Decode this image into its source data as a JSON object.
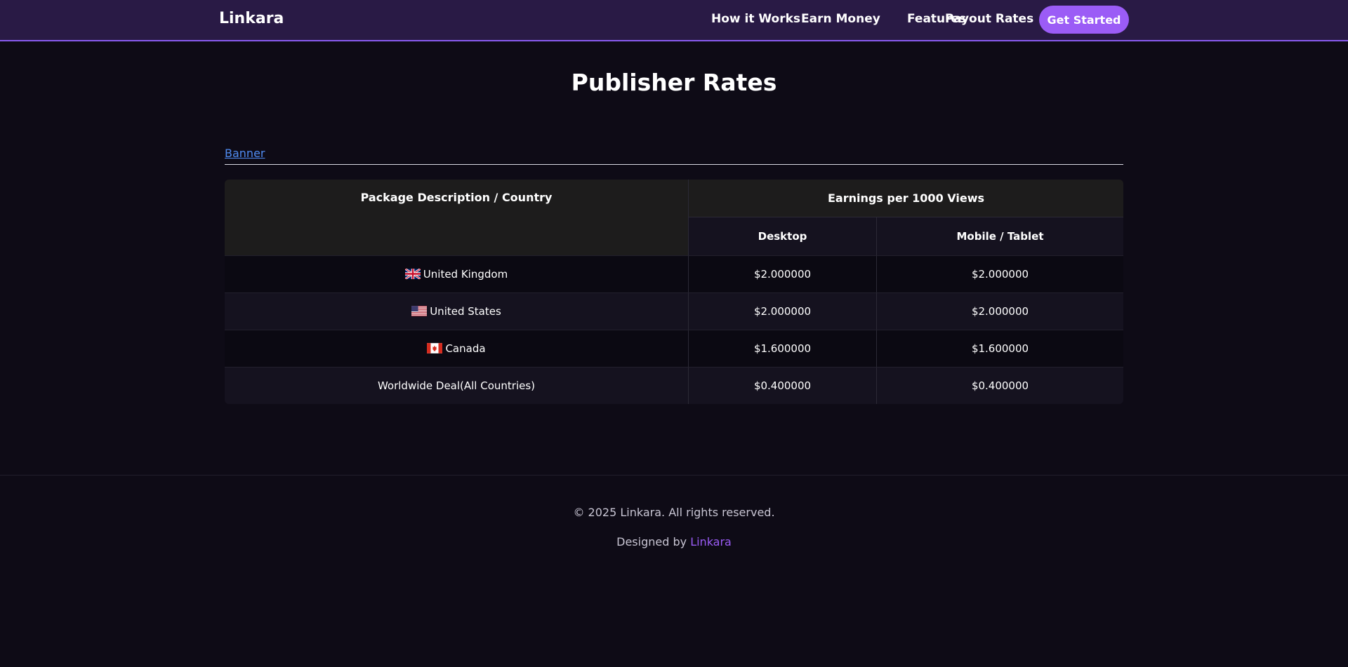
{
  "navbar": {
    "brand": "Linkara",
    "links": [
      "How it Works",
      "Earn Money",
      "Features",
      "Payout Rates"
    ],
    "cta_label": "Get Started"
  },
  "page": {
    "title": "Publisher Rates"
  },
  "tabs": {
    "active": "Banner"
  },
  "rates_table": {
    "headers": {
      "package": "Package Description / Country",
      "earnings": "Earnings per 1000 Views",
      "desktop": "Desktop",
      "mobile": "Mobile / Tablet"
    },
    "rows": [
      {
        "flag": "uk-flag-icon",
        "country": "United Kingdom",
        "desktop": "$2.000000",
        "mobile": "$2.000000"
      },
      {
        "flag": "us-flag-icon",
        "country": "United States",
        "desktop": "$2.000000",
        "mobile": "$2.000000"
      },
      {
        "flag": "canada-flag-icon",
        "country": "Canada",
        "desktop": "$1.600000",
        "mobile": "$1.600000"
      },
      {
        "flag": "",
        "country": "Worldwide Deal(All Countries)",
        "desktop": "$0.400000",
        "mobile": "$0.400000"
      }
    ]
  },
  "footer": {
    "copyright": "© 2025 Linkara. All rights reserved.",
    "designed_prefix": "Designed by ",
    "designed_link": "Linkara"
  },
  "colors": {
    "accent": "#9b5cf6",
    "navbar_bg": "#291a45",
    "page_bg": "#0e0b16",
    "link_blue": "#4f8bf0"
  }
}
